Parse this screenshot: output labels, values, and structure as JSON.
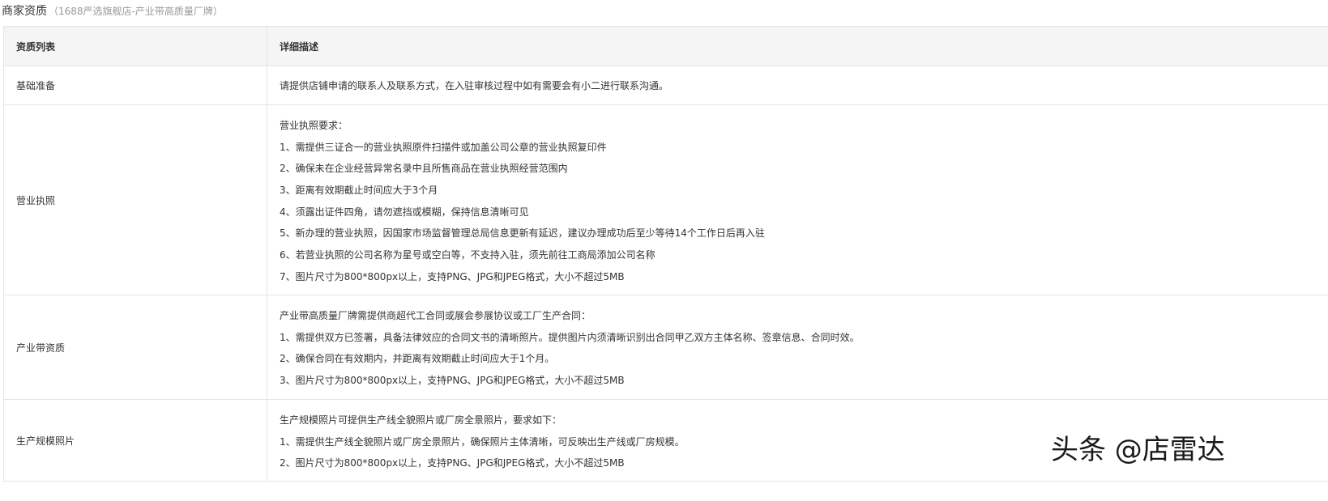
{
  "title": {
    "main": "商家资质",
    "sub": "（1688严选旗舰店-产业带高质量厂牌）"
  },
  "table": {
    "headers": [
      "资质列表",
      "详细描述"
    ],
    "rows": [
      {
        "name": "基础准备",
        "lines": [
          "请提供店铺申请的联系人及联系方式，在入驻审核过程中如有需要会有小二进行联系沟通。"
        ]
      },
      {
        "name": "营业执照",
        "lines": [
          "营业执照要求：",
          "1、需提供三证合一的营业执照原件扫描件或加盖公司公章的营业执照复印件",
          "2、确保未在企业经营异常名录中且所售商品在营业执照经营范围内",
          "3、距离有效期截止时间应大于3个月",
          "4、须露出证件四角，请勿遮挡或模糊，保持信息清晰可见",
          "5、新办理的营业执照，因国家市场监督管理总局信息更新有延迟，建议办理成功后至少等待14个工作日后再入驻",
          "6、若营业执照的公司名称为星号或空白等，不支持入驻，须先前往工商局添加公司名称",
          "7、图片尺寸为800*800px以上，支持PNG、JPG和JPEG格式，大小不超过5MB"
        ]
      },
      {
        "name": "产业带资质",
        "lines": [
          "产业带高质量厂牌需提供商超代工合同或展会参展协议或工厂生产合同：",
          "1、需提供双方已签署，具备法律效应的合同文书的清晰照片。提供图片内须清晰识别出合同甲乙双方主体名称、签章信息、合同时效。",
          "2、确保合同在有效期内，并距离有效期截止时间应大于1个月。",
          "3、图片尺寸为800*800px以上，支持PNG、JPG和JPEG格式，大小不超过5MB"
        ]
      },
      {
        "name": "生产规模照片",
        "lines": [
          "生产规模照片可提供生产线全貌照片或厂房全景照片，要求如下：",
          "1、需提供生产线全貌照片或厂房全景照片，确保照片主体清晰，可反映出生产线或厂房规模。",
          "2、图片尺寸为800*800px以上，支持PNG、JPG和JPEG格式，大小不超过5MB"
        ]
      }
    ]
  },
  "watermark": "头条 @店雷达"
}
